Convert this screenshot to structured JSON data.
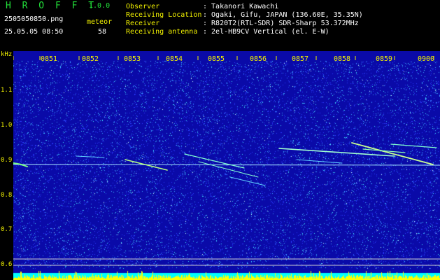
{
  "app": {
    "name": "H R O F F T",
    "version": "1.0.0"
  },
  "capture": {
    "filename": "2505050850.png",
    "datetime": "25.05.05 08:50",
    "meteor_label": "meteor",
    "meteor_count": "58"
  },
  "info": [
    {
      "label": "Observer",
      "value": ": Takanori Kawachi"
    },
    {
      "label": "Receiving Location",
      "value": ": Ogaki, Gifu, JAPAN (136.60E, 35.35N)"
    },
    {
      "label": "Receiver",
      "value": ": R820T2(RTL-SDR) SDR-Sharp 53.372MHz"
    },
    {
      "label": "Receiving antenna",
      "value": ": 2el-HB9CV Vertical (el. E-W)"
    }
  ],
  "axis": {
    "y_unit": "kHz",
    "y_ticks": [
      "1.1",
      "1.0",
      "0.9",
      "0.8",
      "0.7",
      "0.6"
    ],
    "x_ticks": [
      "0851",
      "0852",
      "0853",
      "0854",
      "0855",
      "0856",
      "0857",
      "0858",
      "0859",
      "0900"
    ]
  },
  "colors": {
    "label_green": "#22e03a",
    "label_yellow": "#f3f300",
    "background_blue": "#0a0aa8",
    "noise_cyan": "#00ffff",
    "signal_bar": "#ffff00"
  }
}
